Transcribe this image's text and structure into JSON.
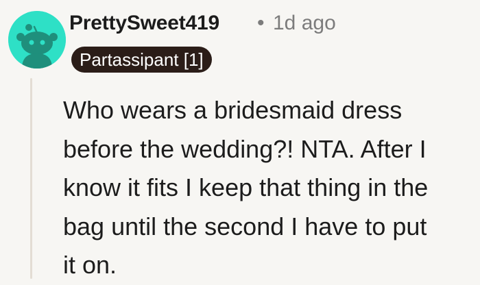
{
  "comment": {
    "avatar_icon": "reddit-snoo-avatar-icon",
    "avatar_color": "#2ee0c6",
    "username": "PrettySweet419",
    "separator": "•",
    "timestamp": "1d ago",
    "flair": "Partassipant [1]",
    "flair_color": "#2b1d18",
    "body_lines": [
      "Who wears a bridesmaid dress",
      "before the wedding?! NTA. After I",
      "know it fits I keep that thing in the",
      "bag until the second I have to put",
      "it on."
    ]
  }
}
